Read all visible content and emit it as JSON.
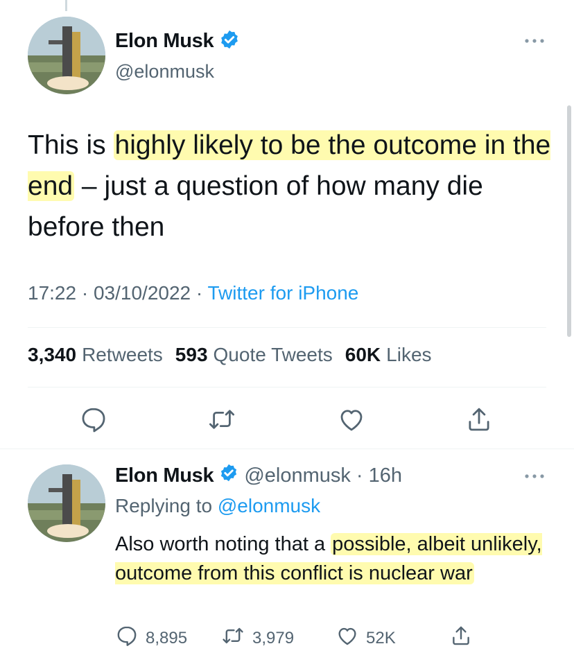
{
  "main_tweet": {
    "author_name": "Elon Musk",
    "handle": "@elonmusk",
    "text_parts": [
      {
        "text": "This is ",
        "highlighted": false
      },
      {
        "text": "highly likely to be the outcome in the end",
        "highlighted": true
      },
      {
        "text": " – just a question of how many die before then",
        "highlighted": false
      }
    ],
    "time": "17:22",
    "date": "03/10/2022",
    "meta_sep": "·",
    "source": "Twitter for iPhone",
    "stats": [
      {
        "count": "3,340",
        "label": "Retweets"
      },
      {
        "count": "593",
        "label": "Quote Tweets"
      },
      {
        "count": "60K",
        "label": "Likes"
      }
    ]
  },
  "reply_tweet": {
    "author_name": "Elon Musk",
    "handle": "@elonmusk",
    "time_ago": "· 16h",
    "replying_prefix": "Replying to",
    "replying_to": "@elonmusk",
    "text_parts": [
      {
        "text": "Also worth noting that a ",
        "highlighted": false
      },
      {
        "text": "possible, albeit unlikely, outcome from this conflict is nuclear war",
        "highlighted": true
      }
    ],
    "counts": {
      "replies": "8,895",
      "retweets": "3,979",
      "likes": "52K"
    }
  },
  "colors": {
    "accent": "#1d9bf0",
    "secondary_text": "#536471",
    "highlight": "#fff76e",
    "verified": "#1d9bf0"
  },
  "icons": [
    "verified-icon",
    "more-icon",
    "reply-icon",
    "retweet-icon",
    "like-icon",
    "share-icon"
  ]
}
